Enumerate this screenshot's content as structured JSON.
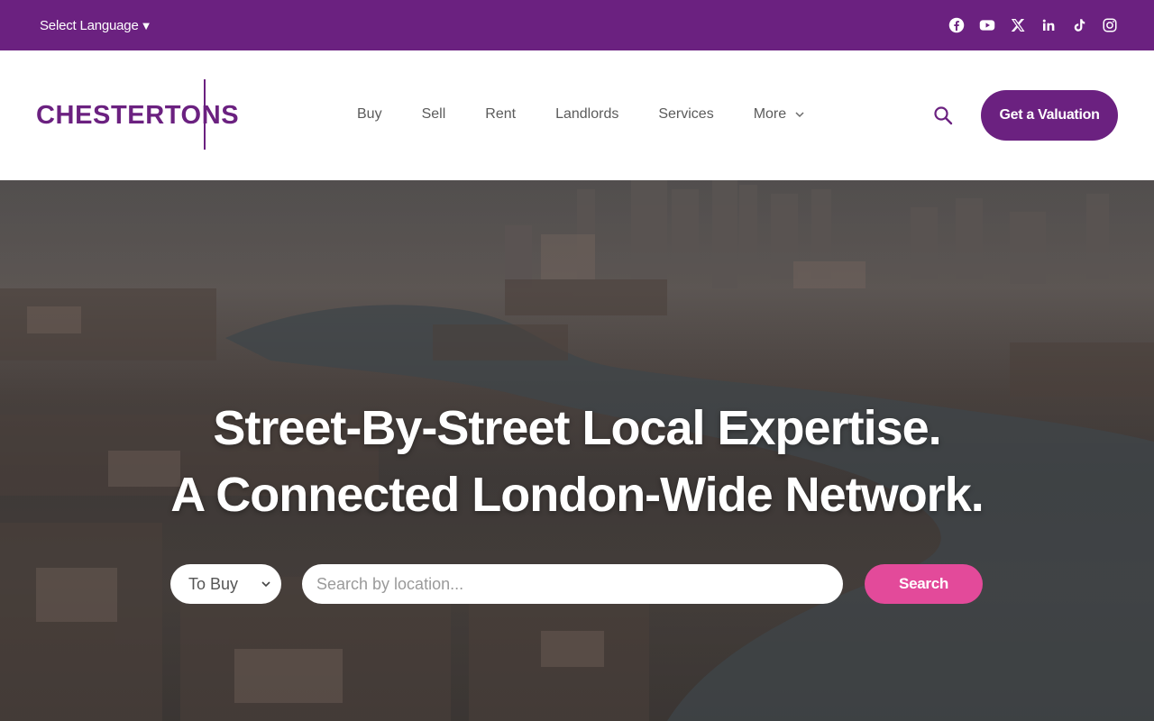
{
  "topbar": {
    "language_label": "Select Language",
    "language_caret": "▼",
    "social_icons": [
      "facebook-icon",
      "youtube-icon",
      "x-icon",
      "linkedin-icon",
      "tiktok-icon",
      "instagram-icon"
    ]
  },
  "header": {
    "logo_text": "CHESTERTONS",
    "nav": [
      "Buy",
      "Sell",
      "Rent",
      "Landlords",
      "Services",
      "More"
    ],
    "cta_label": "Get a Valuation"
  },
  "hero": {
    "headline_1": "Street-By-Street Local Expertise.",
    "headline_2": "A Connected London-Wide Network.",
    "select_value": "To Buy",
    "search_placeholder": "Search by location...",
    "search_button": "Search"
  },
  "colors": {
    "brand_purple": "#6b2180",
    "search_pink": "#e34a9a"
  }
}
